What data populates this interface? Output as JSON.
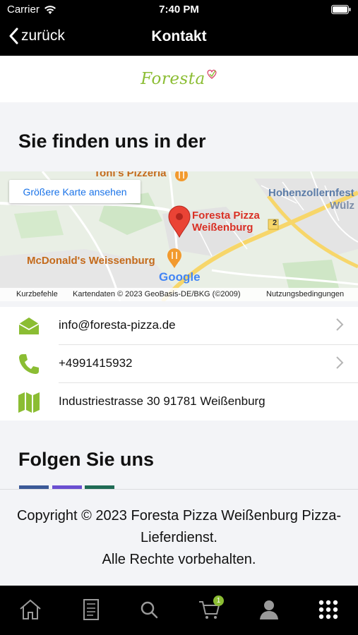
{
  "status_bar": {
    "carrier": "Carrier",
    "time": "7:40 PM"
  },
  "nav": {
    "back_label": "zurück",
    "title": "Kontakt"
  },
  "logo": {
    "text": "Foresta"
  },
  "location_section": {
    "heading": "Sie finden uns in der"
  },
  "map": {
    "larger_map_button": "Größere Karte ansehen",
    "pin_label_line1": "Foresta Pizza",
    "pin_label_line2": "Weißenburg",
    "poi_toni": "Toni's Pizzeria",
    "poi_mcdonalds": "McDonald's Weissenburg",
    "place_hohenzollern": "Hohenzollernfest",
    "place_wulz": "Wülz",
    "road_number": "2",
    "google": "Google",
    "footer_shortcuts": "Kurzbefehle",
    "footer_data": "Kartendaten © 2023 GeoBasis-DE/BKG (©2009)",
    "footer_terms": "Nutzungsbedingungen"
  },
  "contacts": {
    "email": "info@foresta-pizza.de",
    "phone": "+4991415932",
    "address": "Industriestrasse 30  91781 Weißenburg"
  },
  "follow_section": {
    "heading": "Folgen Sie uns"
  },
  "footer": {
    "line1": "Copyright © 2023 Foresta Pizza Weißenburg Pizza-",
    "line2": "Lieferdienst.",
    "line3": "Alle Rechte vorbehalten."
  },
  "tab_bar": {
    "cart_count": "1"
  },
  "colors": {
    "accent": "#8bbd33",
    "bar_bg": "#000000",
    "link_blue": "#1a73e8"
  }
}
